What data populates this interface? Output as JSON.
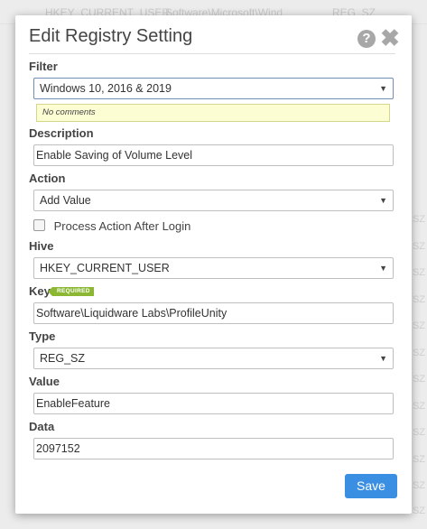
{
  "background": {
    "row1": {
      "col1": "HKEY_CURRENT_USER",
      "col2": "Software\\Microsoft\\Wind",
      "col3": "REG_SZ"
    },
    "right_col": "SZ"
  },
  "dialog": {
    "title": "Edit Registry Setting",
    "icons": {
      "help": "help-icon",
      "close": "close-icon"
    }
  },
  "filter": {
    "label": "Filter",
    "value": "Windows 10, 2016 & 2019",
    "comment": "No comments"
  },
  "description": {
    "label": "Description",
    "value": "Enable Saving of Volume Level"
  },
  "action": {
    "label": "Action",
    "value": "Add Value"
  },
  "process_after_login": {
    "label": "Process Action After Login",
    "checked": false
  },
  "hive": {
    "label": "Hive",
    "value": "HKEY_CURRENT_USER"
  },
  "key": {
    "label": "Key",
    "badge": "REQUIRED",
    "value": "Software\\Liquidware Labs\\ProfileUnity"
  },
  "type": {
    "label": "Type",
    "value": "REG_SZ"
  },
  "value_field": {
    "label": "Value",
    "value": "EnableFeature"
  },
  "data_field": {
    "label": "Data",
    "value": "2097152"
  },
  "save_label": "Save",
  "colors": {
    "accent": "#3a8fe3",
    "required": "#8bb733",
    "comment_bg": "#fdfdd4"
  }
}
